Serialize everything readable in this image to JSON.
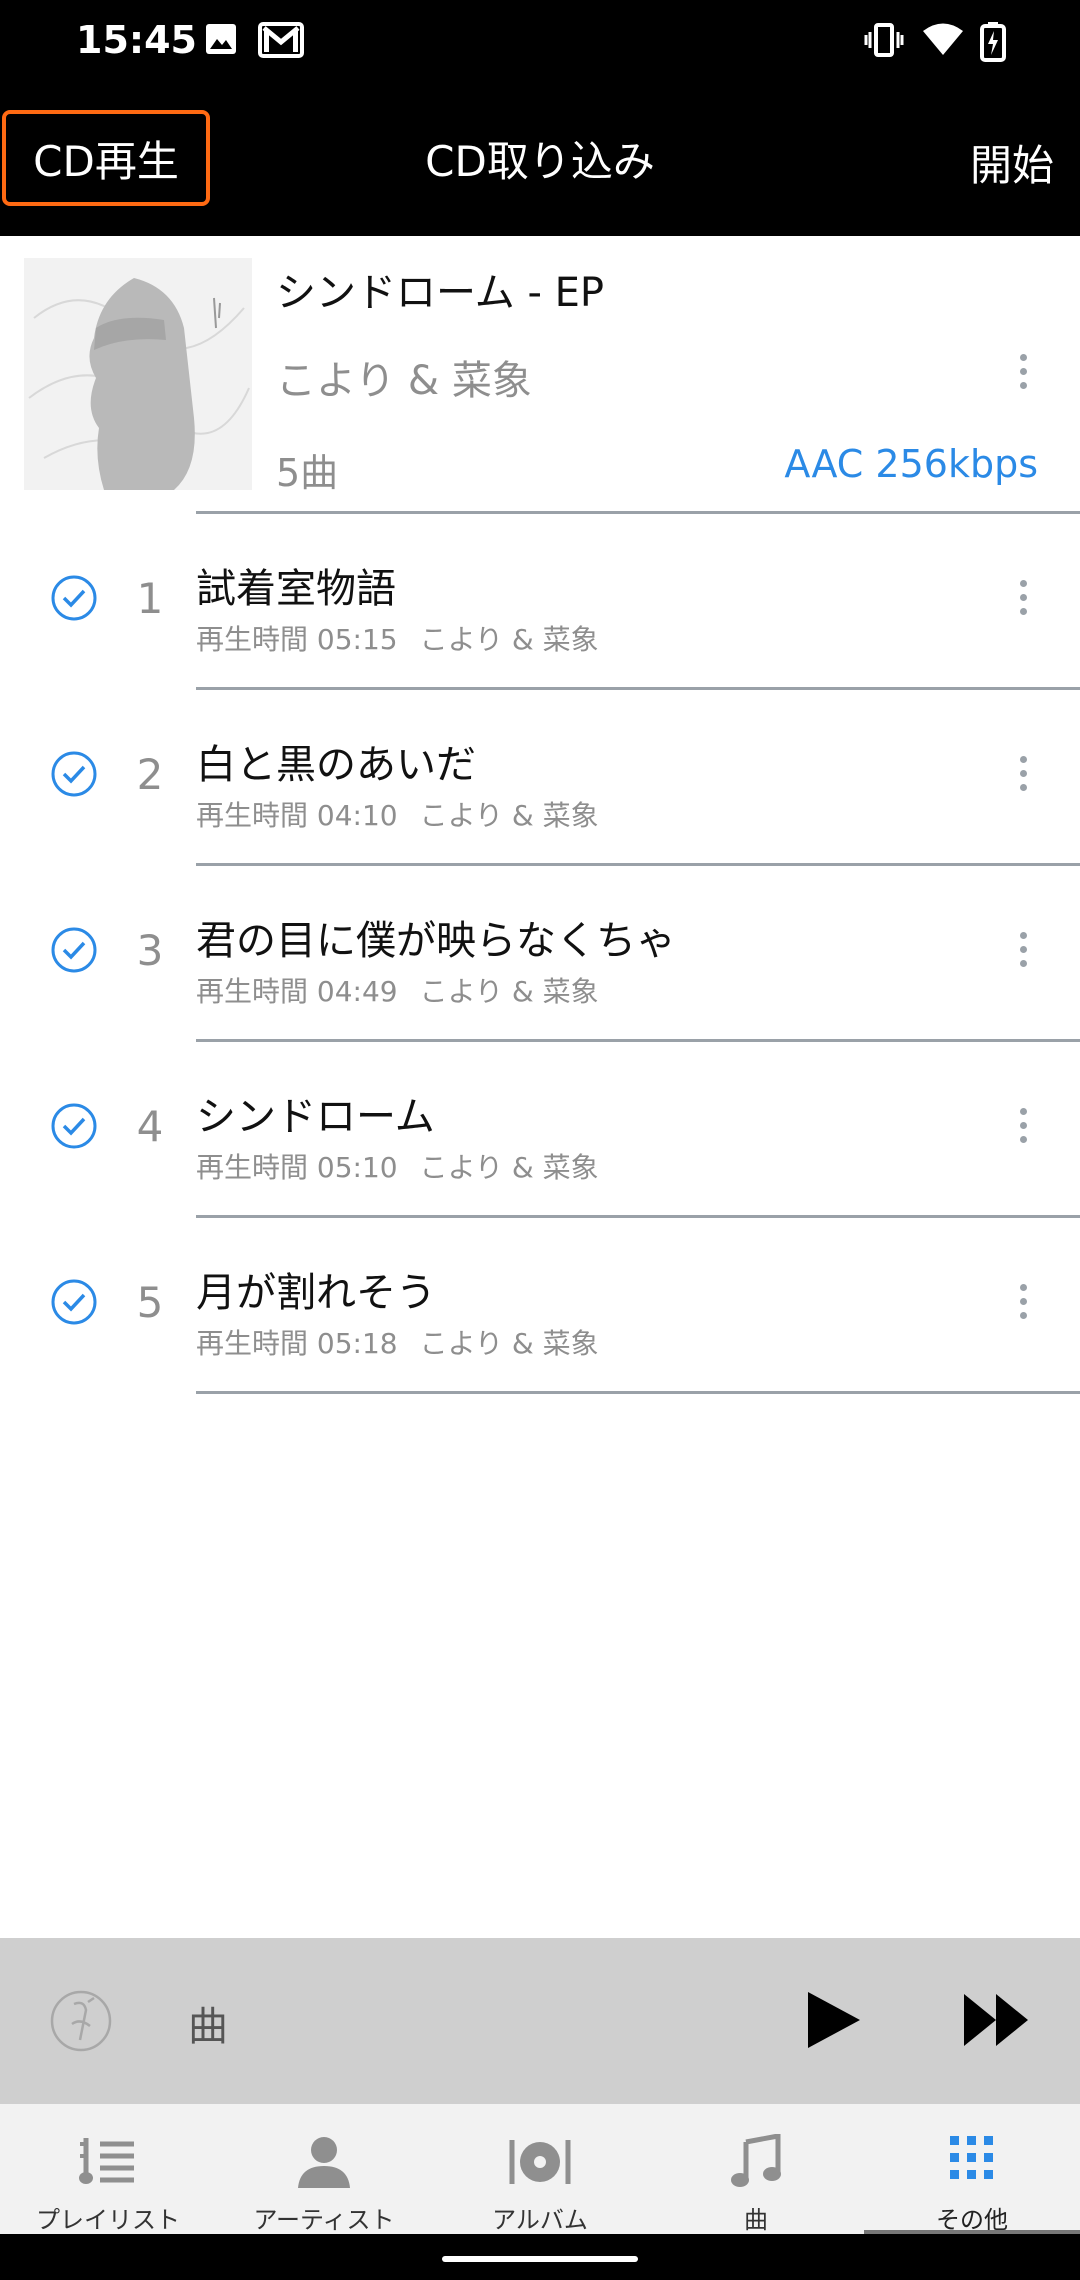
{
  "status_bar": {
    "time": "15:45"
  },
  "app_bar": {
    "left_button": "CD再生",
    "title": "CD取り込み",
    "right_button": "開始"
  },
  "album": {
    "title": "シンドローム - EP",
    "artist": "こより & 菜象",
    "track_count": "5曲",
    "format": "AAC 256kbps"
  },
  "tracks": [
    {
      "number": "1",
      "title": "試着室物語",
      "duration": "再生時間 05:15",
      "artist": "こより & 菜象"
    },
    {
      "number": "2",
      "title": "白と黒のあいだ",
      "duration": "再生時間 04:10",
      "artist": "こより & 菜象"
    },
    {
      "number": "3",
      "title": "君の目に僕が映らなくちゃ",
      "duration": "再生時間 04:49",
      "artist": "こより & 菜象"
    },
    {
      "number": "4",
      "title": "シンドローム",
      "duration": "再生時間 05:10",
      "artist": "こより & 菜象"
    },
    {
      "number": "5",
      "title": "月が割れそう",
      "duration": "再生時間 05:18",
      "artist": "こより & 菜象"
    }
  ],
  "player": {
    "song_label": "曲"
  },
  "nav": {
    "items": [
      {
        "label": "プレイリスト",
        "icon": "playlist-icon"
      },
      {
        "label": "アーティスト",
        "icon": "artist-icon"
      },
      {
        "label": "アルバム",
        "icon": "album-icon"
      },
      {
        "label": "曲",
        "icon": "music-note-icon"
      },
      {
        "label": "その他",
        "icon": "grid-icon"
      }
    ],
    "active_index": 4
  },
  "colors": {
    "accent": "#2b8ae6",
    "highlight_border": "#ff6a13",
    "bar_background": "#000000",
    "player_background": "#cfcfcf"
  }
}
